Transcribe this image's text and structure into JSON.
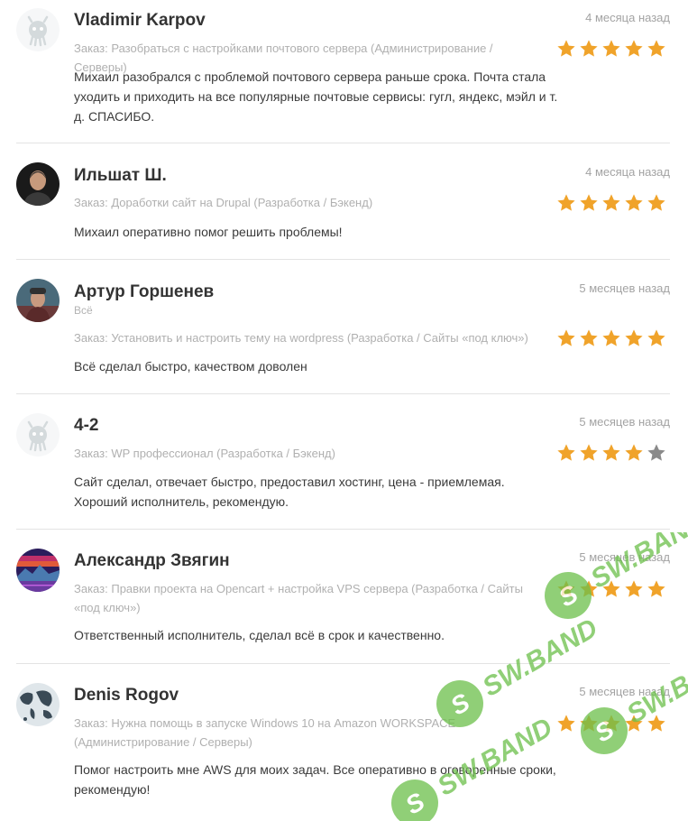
{
  "reviews": [
    {
      "name": "Vladimir Karpov",
      "date": "4 месяца назад",
      "order_label": "Заказ:",
      "order": "Разобраться с настройками почтового сервера (Администрирование / Серверы)",
      "text": "Михаил разобрался с проблемой почтового сервера раньше срока. Почта стала уходить и приходить на все популярные почтовые сервисы: гугл, яндекс, мэйл и т. д. СПАСИБО.",
      "rating": 5,
      "avatar": "placeholder-robot-icon"
    },
    {
      "name": "Ильшат Ш.",
      "date": "4 месяца назад",
      "order_label": "Заказ:",
      "order": "Доработки сайт на Drupal (Разработка / Бэкенд)",
      "text": "Михаил оперативно помог решить проблемы!",
      "rating": 5,
      "avatar": "user-photo"
    },
    {
      "name": "Артур Горшенев",
      "date": "5 месяцев назад",
      "subtitle": "Всё",
      "order_label": "Заказ:",
      "order": "Установить и настроить тему на wordpress (Разработка / Сайты «под ключ»)",
      "text": "Всё сделал быстро, качеством доволен",
      "rating": 5,
      "avatar": "user-photo"
    },
    {
      "name": "4-2",
      "date": "5 месяцев назад",
      "order_label": "Заказ:",
      "order": "WP профессионал (Разработка / Бэкенд)",
      "text": "Сайт сделал, отвечает быстро, предоставил хостинг, цена - приемлемая. Хороший исполнитель, рекомендую.",
      "rating": 4,
      "avatar": "placeholder-robot-icon"
    },
    {
      "name": "Александр Звягин",
      "date": "5 месяцев назад",
      "order_label": "Заказ:",
      "order": "Правки проекта на Opencart + настройка VPS сервера (Разработка / Сайты «под ключ»)",
      "text": "Ответственный исполнитель, сделал всё в срок и качественно.",
      "rating": 5,
      "avatar": "synthwave-picture"
    },
    {
      "name": "Denis Rogov",
      "date": "5 месяцев назад",
      "order_label": "Заказ:",
      "order": "Нужна помощь в запуске Windows 10 на Amazon WORKSPACE (Администрирование / Серверы)",
      "text": "Помог настроить мне AWS для моих задач. Все оперативно в оговоренные сроки, рекомендую!",
      "rating": 5,
      "avatar": "world-map-picture"
    }
  ],
  "watermark": {
    "text": "SW.BAND"
  },
  "colors": {
    "star": "#f0a32a",
    "star_off": "#8a8a8a",
    "muted": "#b0b0b0",
    "watermark": "#6cc04a"
  }
}
